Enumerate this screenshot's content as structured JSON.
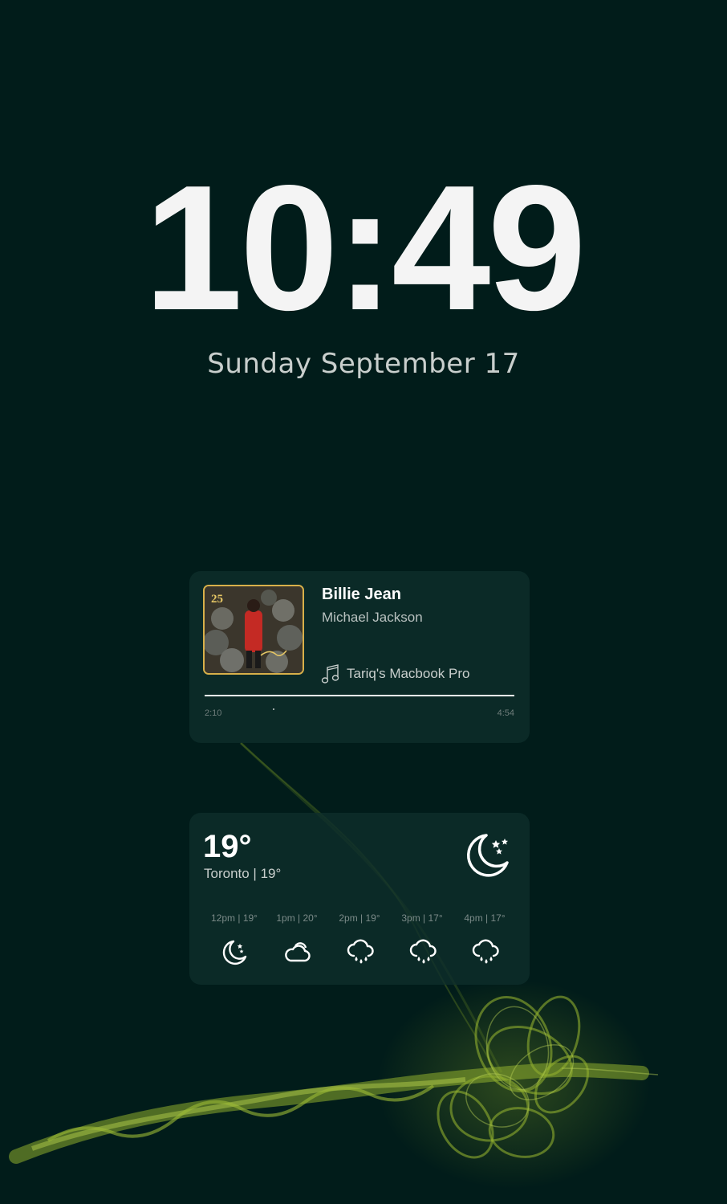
{
  "clock": {
    "time": "10:49",
    "date": "Sunday September 17"
  },
  "now_playing": {
    "title": "Billie Jean",
    "artist": "Michael Jackson",
    "device": "Tariq's Macbook Pro",
    "elapsed": "2:10",
    "duration": "4:54",
    "progress_fraction": 1.0,
    "album_badge": "25",
    "icons": {
      "device": "music-note-icon"
    }
  },
  "weather": {
    "temperature": "19°",
    "location": "Toronto | 19°",
    "current_icon": "moon-stars-icon",
    "forecast": [
      {
        "label": "12pm | 19°",
        "icon": "moon-stars-icon"
      },
      {
        "label": "1pm | 20°",
        "icon": "cloud-icon"
      },
      {
        "label": "2pm | 19°",
        "icon": "rain-cloud-icon"
      },
      {
        "label": "3pm | 17°",
        "icon": "rain-cloud-icon"
      },
      {
        "label": "4pm | 17°",
        "icon": "rain-cloud-icon"
      }
    ]
  },
  "colors": {
    "background": "#011c1a",
    "card": "#0e2e2c",
    "accent_green": "#8fae2e",
    "album_border": "#d8b04a"
  }
}
